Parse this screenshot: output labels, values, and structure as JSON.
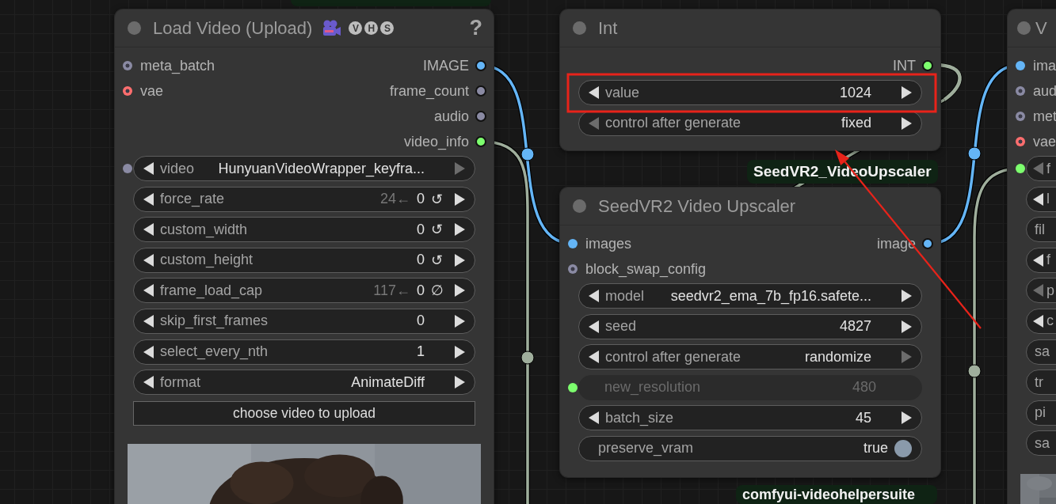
{
  "nodes": [
    {
      "title": "Load Video (Upload)",
      "badges": [
        "V",
        "H",
        "S"
      ],
      "help": "?",
      "slots": [
        {
          "input": {
            "name": "meta_batch",
            "color": "#8a8aa3",
            "linked": false
          },
          "output": {
            "name": "IMAGE",
            "color": "#64b5f6"
          }
        },
        {
          "input": {
            "name": "vae",
            "color": "#ff6e6e",
            "linked": false
          },
          "output": {
            "name": "frame_count",
            "color": "#8a8aa3"
          }
        },
        {
          "output": {
            "name": "audio",
            "color": "#8a8aa3"
          }
        },
        {
          "output": {
            "name": "video_info",
            "color": "#7dff6e"
          }
        }
      ],
      "widgets": [
        {
          "kind": "combo",
          "label": "video",
          "value": "HunyuanVideoWrapper_keyfra...",
          "left_enabled": true,
          "right_enabled": false,
          "input": {
            "color": "#8a8aa3"
          }
        },
        {
          "kind": "number",
          "label": "force_rate",
          "hint": "24←",
          "value": "0",
          "suffix": "↺",
          "left_enabled": true,
          "right_enabled": true
        },
        {
          "kind": "number",
          "label": "custom_width",
          "value": "0",
          "suffix": "↺",
          "left_enabled": true,
          "right_enabled": true
        },
        {
          "kind": "number",
          "label": "custom_height",
          "value": "0",
          "suffix": "↺",
          "left_enabled": true,
          "right_enabled": true
        },
        {
          "kind": "number",
          "label": "frame_load_cap",
          "hint": "117←",
          "value": "0",
          "suffix": "∅",
          "left_enabled": true,
          "right_enabled": true
        },
        {
          "kind": "number",
          "label": "skip_first_frames",
          "value": "0",
          "left_enabled": true,
          "right_enabled": true
        },
        {
          "kind": "number",
          "label": "select_every_nth",
          "value": "1",
          "left_enabled": true,
          "right_enabled": true
        },
        {
          "kind": "combo",
          "label": "format",
          "value": "AnimateDiff",
          "left_enabled": true,
          "right_enabled": true
        },
        {
          "kind": "button",
          "label": "choose video to upload"
        }
      ],
      "preview": {
        "kind": "picture"
      }
    },
    {
      "title": "Int",
      "slots": [
        {
          "output": {
            "name": "INT",
            "color": "#7dff6e"
          }
        }
      ],
      "widgets": [
        {
          "kind": "number",
          "label": "value",
          "value": "1024",
          "left_enabled": true,
          "right_enabled": true
        },
        {
          "kind": "combo",
          "label": "control after generate",
          "value": "fixed",
          "left_enabled": false,
          "right_enabled": true
        }
      ]
    },
    {
      "title": "SeedVR2 Video Upscaler",
      "slots": [
        {
          "input": {
            "name": "images",
            "color": "#64b5f6",
            "linked": true
          },
          "output": {
            "name": "image",
            "color": "#64b5f6"
          }
        },
        {
          "input": {
            "name": "block_swap_config",
            "color": "#8a8aa3",
            "linked": false
          }
        }
      ],
      "widgets": [
        {
          "kind": "combo",
          "label": "model",
          "value": "seedvr2_ema_7b_fp16.safete...",
          "left_enabled": true,
          "right_enabled": true
        },
        {
          "kind": "number",
          "label": "seed",
          "value": "4827",
          "left_enabled": true,
          "right_enabled": true
        },
        {
          "kind": "combo",
          "label": "control after generate",
          "value": "randomize",
          "left_enabled": true,
          "right_enabled": false
        },
        {
          "kind": "converted",
          "label": "new_resolution",
          "value": "480",
          "input": {
            "color": "#7dff6e"
          }
        },
        {
          "kind": "number",
          "label": "batch_size",
          "value": "45",
          "left_enabled": true,
          "right_enabled": true
        },
        {
          "kind": "toggle",
          "label": "preserve_vram",
          "value": "true",
          "on": true
        }
      ]
    },
    {
      "title": "V",
      "slots": [
        {
          "input": {
            "name": "ima",
            "color": "#64b5f6",
            "linked": true
          }
        },
        {
          "input": {
            "name": "aud",
            "color": "#8a8aa3",
            "linked": false
          }
        },
        {
          "input": {
            "name": "met",
            "color": "#8a8aa3",
            "linked": false
          }
        },
        {
          "input": {
            "name": "vae",
            "color": "#ff6e6e",
            "linked": false
          }
        }
      ],
      "widgets": [
        {
          "kind": "combo",
          "label": "f",
          "left_enabled": false,
          "input": {
            "color": "#7dff6e"
          }
        },
        {
          "kind": "combo",
          "label": "l",
          "left_enabled": true
        },
        {
          "kind": "plain",
          "label": "fil"
        },
        {
          "kind": "combo",
          "label": "f",
          "left_enabled": true
        },
        {
          "kind": "combo",
          "label": "p",
          "left_enabled": false
        },
        {
          "kind": "combo",
          "label": "c",
          "left_enabled": true
        },
        {
          "kind": "plain",
          "label": "sa"
        },
        {
          "kind": "plain",
          "label": "tr"
        },
        {
          "kind": "plain",
          "label": "pi"
        },
        {
          "kind": "plain",
          "label": "sa"
        }
      ],
      "preview": {
        "kind": "picture"
      }
    }
  ],
  "labels": [
    {
      "text": "SeedVR2_VideoUpscaler"
    },
    {
      "text": "comfyui-videohelpersuite"
    }
  ],
  "links": [
    {
      "color": "#64b5f6"
    },
    {
      "color": "#64b5f6"
    },
    {
      "color": "#9fae9c"
    },
    {
      "color": "#9fae9c"
    },
    {
      "color": "#9fae9c"
    }
  ],
  "annotations": [
    {
      "kind": "highlight"
    },
    {
      "kind": "arrow"
    }
  ]
}
